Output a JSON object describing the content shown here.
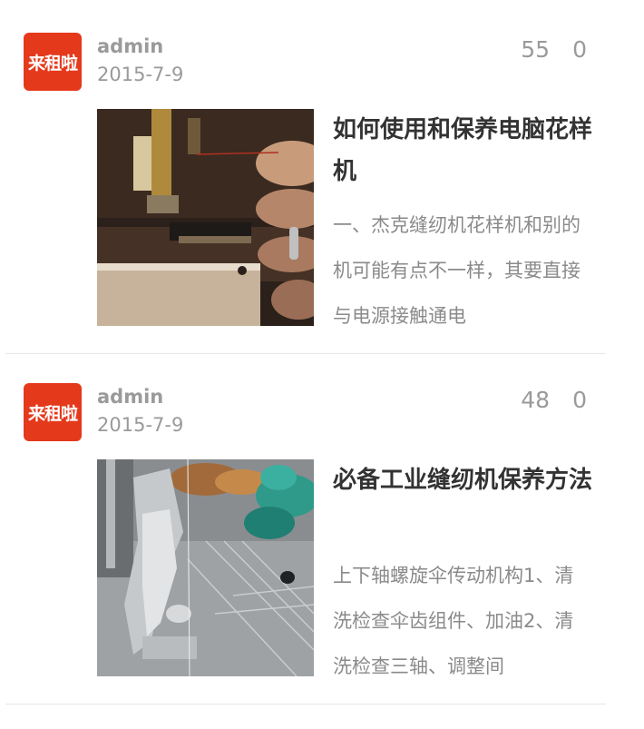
{
  "colors": {
    "brand_red": "#e5391c",
    "text_muted": "#9a9a9a",
    "divider": "#e6e6e6"
  },
  "posts": [
    {
      "author": "admin",
      "date": "2015-7-9",
      "views": "55",
      "comments": "0",
      "avatar_text": "来租啦",
      "title": "如何使用和保养电脑花样机",
      "excerpt": "一、杰克缝纫机花样机和别的机可能有点不一样，其要直接与电源接触通电"
    },
    {
      "author": "admin",
      "date": "2015-7-9",
      "views": "48",
      "comments": "0",
      "avatar_text": "来租啦",
      "title": "必备工业缝纫机保养方法",
      "excerpt": "上下轴螺旋伞传动机构1、清洗检查伞齿组件、加油2、清洗检查三轴、调整间"
    }
  ]
}
